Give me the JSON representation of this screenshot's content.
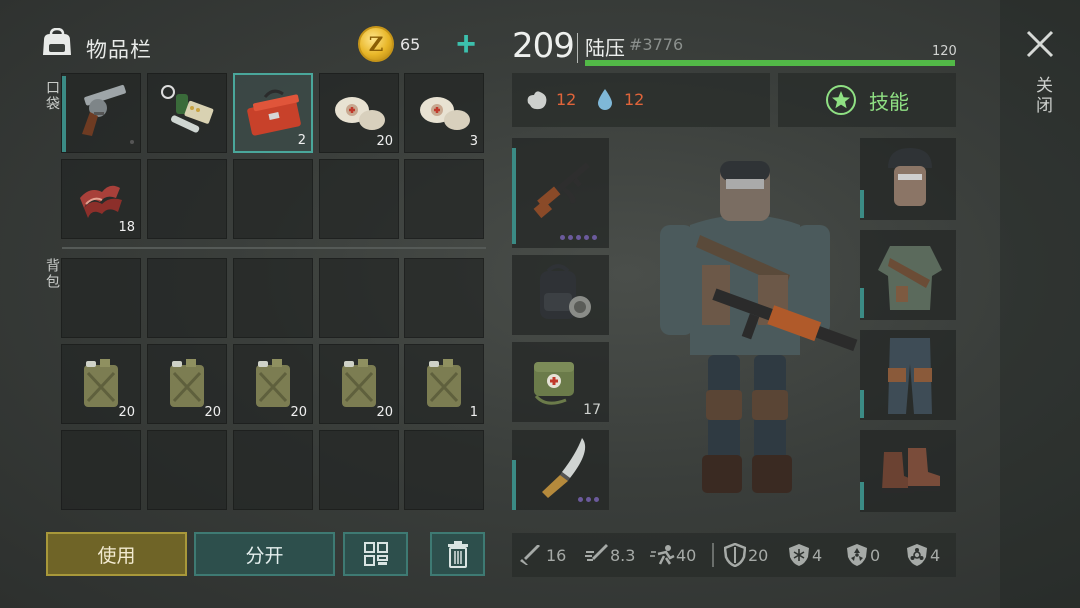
{
  "inventory": {
    "title": "物品栏",
    "coins": "65",
    "pocket_label": "口袋",
    "backpack_label": "背包",
    "pocket_slots": [
      {
        "icon": "revolver-icon",
        "count": ""
      },
      {
        "icon": "medkit-supplies-icon",
        "count": ""
      },
      {
        "icon": "toolbox-icon",
        "count": "2"
      },
      {
        "icon": "bandage-icon",
        "count": "20"
      },
      {
        "icon": "bandage-icon",
        "count": "3"
      },
      {
        "icon": "bacon-icon",
        "count": "18"
      }
    ],
    "backpack_slots": [
      {
        "icon": "fuel-can-icon",
        "count": "20"
      },
      {
        "icon": "fuel-can-icon",
        "count": "20"
      },
      {
        "icon": "fuel-can-icon",
        "count": "20"
      },
      {
        "icon": "fuel-can-icon",
        "count": "20"
      },
      {
        "icon": "fuel-can-icon",
        "count": "1"
      }
    ]
  },
  "actions": {
    "use": "使用",
    "split": "分开"
  },
  "character": {
    "level": "209",
    "name": "陆压",
    "uid": "#3776",
    "xp_value": "120",
    "xp_fraction": 1.0,
    "hunger": "12",
    "thirst": "12",
    "skills_label": "技能"
  },
  "equipment": {
    "weapon_slots": [
      {
        "icon": "assault-rifle-icon",
        "count": ""
      },
      {
        "icon": "backpack-icon",
        "count": ""
      },
      {
        "icon": "medical-bag-icon",
        "count": "17"
      },
      {
        "icon": "machete-icon",
        "count": ""
      }
    ],
    "armor_slots": [
      {
        "icon": "helmet-icon"
      },
      {
        "icon": "jacket-icon"
      },
      {
        "icon": "pants-icon"
      },
      {
        "icon": "boots-icon"
      }
    ]
  },
  "stats": {
    "melee_damage": "16",
    "attack_speed": "8.3",
    "move_speed": "40",
    "armor": "20",
    "cold_resist": "4",
    "radiation_resist": "0",
    "toxic_resist": "4"
  },
  "close_label": "关闭",
  "colors": {
    "accent_teal": "#3cc0ad",
    "xp_green": "#52b947",
    "stat_red": "#e0643a",
    "skill_green": "#8fe083",
    "use_gold": "#a8983a"
  }
}
